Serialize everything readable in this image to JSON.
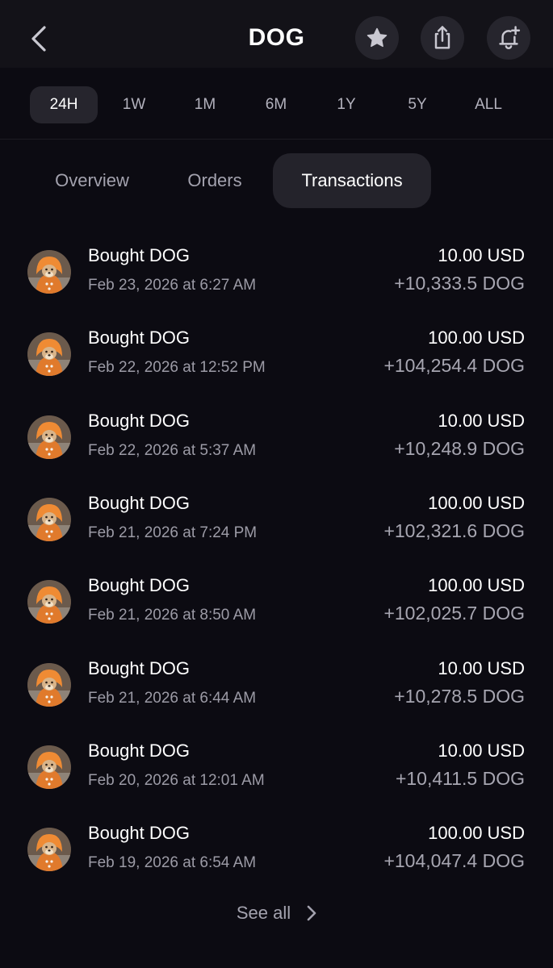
{
  "header": {
    "title": "DOG",
    "icons": [
      "chevron-left-icon",
      "star-icon",
      "share-icon",
      "bell-plus-icon"
    ]
  },
  "ranges": [
    "24H",
    "1W",
    "1M",
    "6M",
    "1Y",
    "5Y",
    "ALL"
  ],
  "active_range": "24H",
  "tabs": [
    "Overview",
    "Orders",
    "Transactions"
  ],
  "active_tab": "Transactions",
  "transactions": [
    {
      "title": "Bought DOG",
      "date": "Feb 23, 2026 at 6:27 AM",
      "usd": "10.00 USD",
      "dog": "+10,333.5 DOG"
    },
    {
      "title": "Bought DOG",
      "date": "Feb 22, 2026 at 12:52 PM",
      "usd": "100.00 USD",
      "dog": "+104,254.4 DOG"
    },
    {
      "title": "Bought DOG",
      "date": "Feb 22, 2026 at 5:37 AM",
      "usd": "10.00 USD",
      "dog": "+10,248.9 DOG"
    },
    {
      "title": "Bought DOG",
      "date": "Feb 21, 2026 at 7:24 PM",
      "usd": "100.00 USD",
      "dog": "+102,321.6 DOG"
    },
    {
      "title": "Bought DOG",
      "date": "Feb 21, 2026 at 8:50 AM",
      "usd": "100.00 USD",
      "dog": "+102,025.7 DOG"
    },
    {
      "title": "Bought DOG",
      "date": "Feb 21, 2026 at 6:44 AM",
      "usd": "10.00 USD",
      "dog": "+10,278.5 DOG"
    },
    {
      "title": "Bought DOG",
      "date": "Feb 20, 2026 at 12:01 AM",
      "usd": "10.00 USD",
      "dog": "+10,411.5 DOG"
    },
    {
      "title": "Bought DOG",
      "date": "Feb 19, 2026 at 6:54 AM",
      "usd": "100.00 USD",
      "dog": "+104,047.4 DOG"
    }
  ],
  "see_all": {
    "label": "See all",
    "icon": "chevron-right-icon"
  },
  "colors": {
    "background": "#0c0b12",
    "pill": "#26252d",
    "secondary_text": "#9c9ba6"
  }
}
